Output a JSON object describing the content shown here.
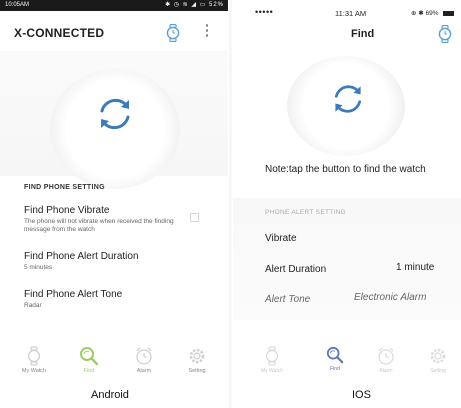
{
  "android": {
    "status_bar": {
      "time": "10:05AM",
      "icons_text": "✱ ◷ ≋ ◢ ▭ 52%"
    },
    "toolbar": {
      "title": "X-CONNECTED"
    },
    "find_button": {
      "icon": "sync-arrows-icon"
    },
    "settings": {
      "section_title": "FIND PHONE SETTING",
      "rows": [
        {
          "title": "Find Phone Vibrate",
          "subtitle": "The phone will not vibrate when received the finding message from the watch"
        },
        {
          "title": "Find Phone Alert Duration",
          "subtitle": "5 minutes"
        },
        {
          "title": "Find Phone Alert Tone",
          "subtitle": "Radar"
        }
      ]
    },
    "nav": [
      {
        "label": "My Watch",
        "icon": "watch-icon"
      },
      {
        "label": "Find",
        "icon": "search-icon"
      },
      {
        "label": "Alarm",
        "icon": "alarm-clock-icon"
      },
      {
        "label": "Setting",
        "icon": "gear-icon"
      }
    ],
    "caption": "Android",
    "colors": {
      "accent_green": "#9ccc6a",
      "sync_blue": "#3d7ab8"
    }
  },
  "ios": {
    "status_bar": {
      "signal_dots": "•••••",
      "time": "11:31 AM",
      "right_text": "⊕ ✱ 69%"
    },
    "nav_bar": {
      "title": "Find"
    },
    "find_button": {
      "icon": "sync-arrows-icon"
    },
    "note": "Note:tap the button to find the watch",
    "settings": {
      "section_title": "PHONE ALERT SETTING",
      "rows": [
        {
          "label": "Vibrate",
          "value": ""
        },
        {
          "label": "Alert Duration",
          "value": "1 minute"
        },
        {
          "label": "Alert Tone",
          "value": "Electronic Alarm"
        }
      ]
    },
    "nav": [
      {
        "label": "My Watch",
        "icon": "watch-icon"
      },
      {
        "label": "Find",
        "icon": "search-icon"
      },
      {
        "label": "Alarm",
        "icon": "alarm-clock-icon"
      },
      {
        "label": "Setting",
        "icon": "gear-icon"
      }
    ],
    "caption": "IOS",
    "colors": {
      "accent_blue": "#5d78b5",
      "sync_blue": "#3d7ab8"
    }
  }
}
